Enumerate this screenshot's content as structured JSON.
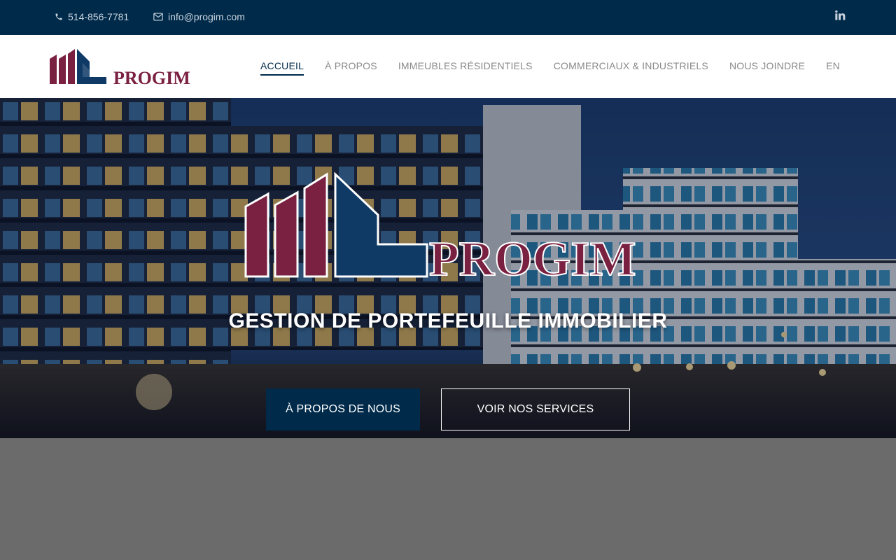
{
  "topbar": {
    "phone": "514-856-7781",
    "email": "info@progim.com",
    "phone_icon": "phone-icon",
    "email_icon": "envelope-icon",
    "social_icon": "linkedin-icon"
  },
  "brand": {
    "name": "PROGIM",
    "colors": {
      "maroon": "#7a2040",
      "navy": "#0f3a66"
    }
  },
  "nav": {
    "items": [
      {
        "label": "ACCUEIL",
        "active": true
      },
      {
        "label": "À PROPOS",
        "active": false
      },
      {
        "label": "IMMEUBLES RÉSIDENTIELS",
        "active": false
      },
      {
        "label": "COMMERCIAUX & INDUSTRIELS",
        "active": false
      },
      {
        "label": "NOUS JOINDRE",
        "active": false
      },
      {
        "label": "EN",
        "active": false
      }
    ]
  },
  "hero": {
    "title": "GESTION DE PORTEFEUILLE IMMOBILIER",
    "primary_button": "À PROPOS DE NOUS",
    "secondary_button": "VOIR NOS SERVICES"
  },
  "colors": {
    "topbar_bg": "#002a4a",
    "accent": "#002a4a",
    "page_bg": "#6b6b6b"
  }
}
